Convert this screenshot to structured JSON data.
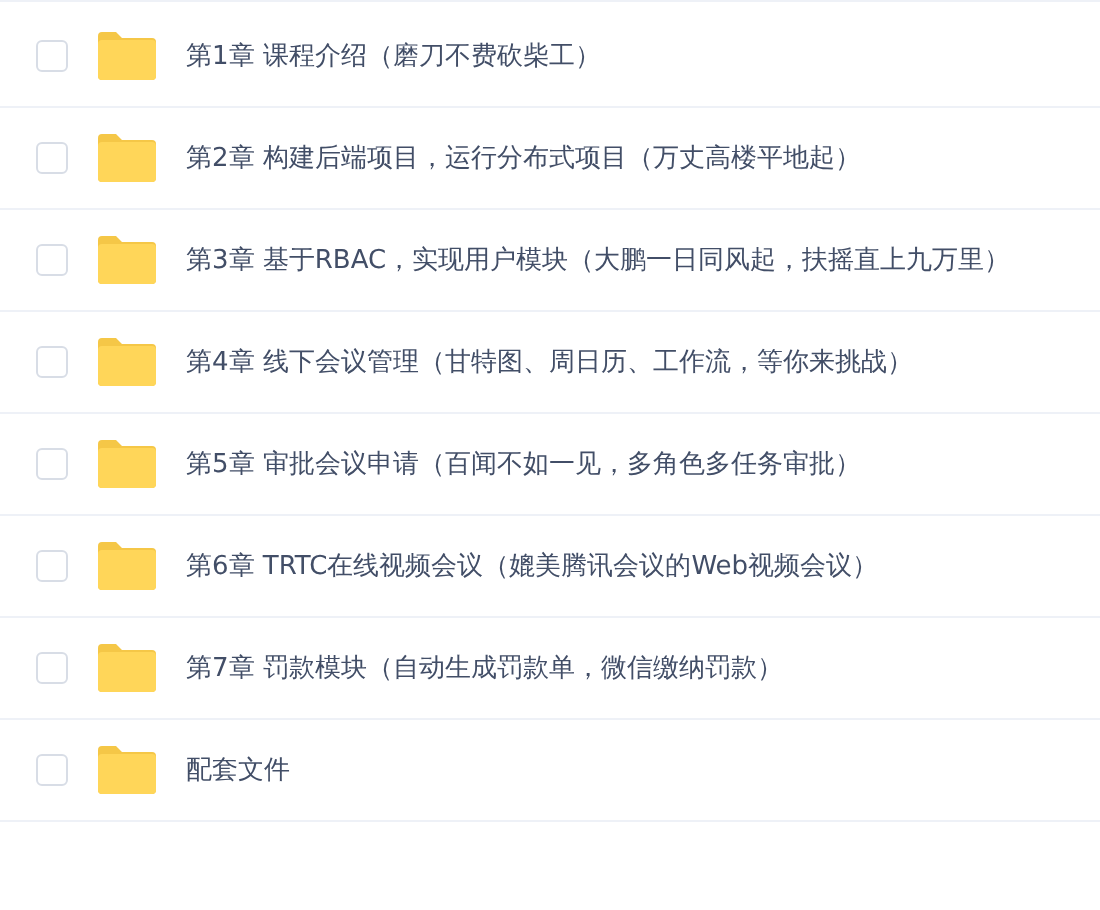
{
  "files": [
    {
      "name": "第1章 课程介绍（磨刀不费砍柴工）",
      "checked": false
    },
    {
      "name": "第2章 构建后端项目，运行分布式项目（万丈高楼平地起）",
      "checked": false
    },
    {
      "name": "第3章 基于RBAC，实现用户模块（大鹏一日同风起，扶摇直上九万里）",
      "checked": false
    },
    {
      "name": "第4章 线下会议管理（甘特图、周日历、工作流，等你来挑战）",
      "checked": false
    },
    {
      "name": "第5章 审批会议申请（百闻不如一见，多角色多任务审批）",
      "checked": false
    },
    {
      "name": "第6章 TRTC在线视频会议（媲美腾讯会议的Web视频会议）",
      "checked": false
    },
    {
      "name": "第7章 罚款模块（自动生成罚款单，微信缴纳罚款）",
      "checked": false
    },
    {
      "name": "配套文件",
      "checked": false
    }
  ]
}
